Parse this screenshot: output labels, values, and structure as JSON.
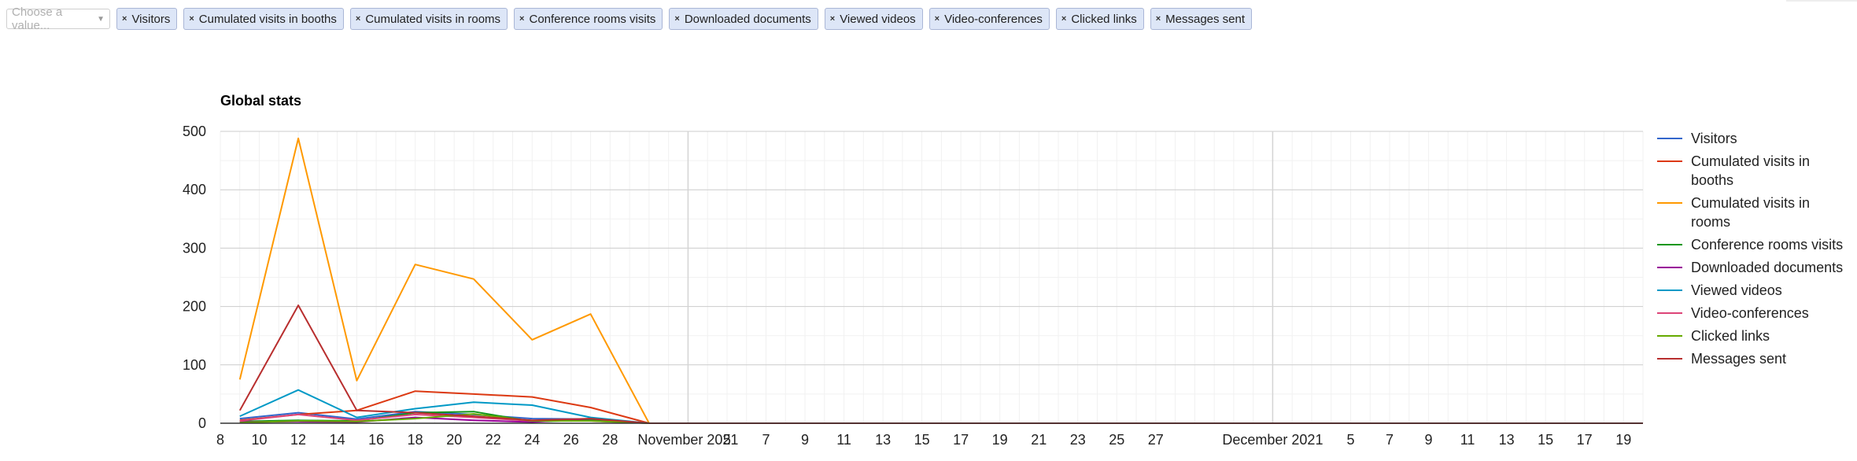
{
  "selector": {
    "placeholder": "Choose a value...",
    "chips": [
      "Visitors",
      "Cumulated visits in booths",
      "Cumulated visits in rooms",
      "Conference rooms visits",
      "Downloaded documents",
      "Viewed videos",
      "Video-conferences",
      "Clicked links",
      "Messages sent"
    ]
  },
  "chart_data": {
    "type": "line",
    "title": "Global stats",
    "xlabel": "",
    "ylabel": "",
    "ylim": [
      0,
      500
    ],
    "yticks": [
      0,
      100,
      200,
      300,
      400,
      500
    ],
    "x": [
      "2021-10-09",
      "2021-10-12",
      "2021-10-15",
      "2021-10-18",
      "2021-10-21",
      "2021-10-24",
      "2021-10-27",
      "2021-10-30",
      "2021-12-20"
    ],
    "xlim": [
      "2021-10-08",
      "2021-12-20"
    ],
    "xtick_labels": [
      {
        "date": "2021-10-08",
        "label": "8"
      },
      {
        "date": "2021-10-10",
        "label": "10"
      },
      {
        "date": "2021-10-12",
        "label": "12"
      },
      {
        "date": "2021-10-14",
        "label": "14"
      },
      {
        "date": "2021-10-16",
        "label": "16"
      },
      {
        "date": "2021-10-18",
        "label": "18"
      },
      {
        "date": "2021-10-20",
        "label": "20"
      },
      {
        "date": "2021-10-22",
        "label": "22"
      },
      {
        "date": "2021-10-24",
        "label": "24"
      },
      {
        "date": "2021-10-26",
        "label": "26"
      },
      {
        "date": "2021-10-28",
        "label": "28"
      },
      {
        "date": "2021-11-01",
        "label": "November 2021"
      },
      {
        "date": "2021-11-03",
        "label": "5"
      },
      {
        "date": "2021-11-05",
        "label": "7"
      },
      {
        "date": "2021-11-07",
        "label": "9"
      },
      {
        "date": "2021-11-09",
        "label": "11"
      },
      {
        "date": "2021-11-11",
        "label": "13"
      },
      {
        "date": "2021-11-13",
        "label": "15"
      },
      {
        "date": "2021-11-15",
        "label": "17"
      },
      {
        "date": "2021-11-17",
        "label": "19"
      },
      {
        "date": "2021-11-19",
        "label": "21"
      },
      {
        "date": "2021-11-21",
        "label": "23"
      },
      {
        "date": "2021-11-23",
        "label": "25"
      },
      {
        "date": "2021-11-25",
        "label": "27"
      },
      {
        "date": "2021-12-01",
        "label": "December 2021"
      },
      {
        "date": "2021-12-05",
        "label": "5"
      },
      {
        "date": "2021-12-07",
        "label": "7"
      },
      {
        "date": "2021-12-09",
        "label": "9"
      },
      {
        "date": "2021-12-11",
        "label": "11"
      },
      {
        "date": "2021-12-13",
        "label": "13"
      },
      {
        "date": "2021-12-15",
        "label": "15"
      },
      {
        "date": "2021-12-17",
        "label": "17"
      },
      {
        "date": "2021-12-19",
        "label": "19"
      }
    ],
    "month_gridlines": [
      "2021-11-01",
      "2021-12-01"
    ],
    "grid": true,
    "legend_position": "right",
    "series": [
      {
        "name": "Visitors",
        "color": "#3366cc",
        "values": [
          8,
          18,
          7,
          20,
          15,
          8,
          7,
          0,
          0
        ]
      },
      {
        "name": "Cumulated visits in booths",
        "color": "#dc3912",
        "values": [
          5,
          15,
          22,
          55,
          50,
          45,
          27,
          0,
          0
        ]
      },
      {
        "name": "Cumulated visits in rooms",
        "color": "#ff9900",
        "values": [
          75,
          488,
          73,
          272,
          247,
          143,
          187,
          0,
          0
        ]
      },
      {
        "name": "Conference rooms visits",
        "color": "#109618",
        "values": [
          3,
          5,
          4,
          18,
          20,
          3,
          5,
          0,
          0
        ]
      },
      {
        "name": "Downloaded documents",
        "color": "#990099",
        "values": [
          2,
          3,
          2,
          10,
          5,
          2,
          8,
          0,
          0
        ]
      },
      {
        "name": "Viewed videos",
        "color": "#0099c6",
        "values": [
          12,
          57,
          10,
          25,
          36,
          31,
          10,
          0,
          0
        ]
      },
      {
        "name": "Video-conferences",
        "color": "#dd4477",
        "values": [
          4,
          15,
          5,
          15,
          10,
          4,
          4,
          0,
          0
        ]
      },
      {
        "name": "Clicked links",
        "color": "#66aa00",
        "values": [
          1,
          4,
          3,
          8,
          16,
          4,
          4,
          0,
          0
        ]
      },
      {
        "name": "Messages sent",
        "color": "#b82e2e",
        "values": [
          22,
          202,
          22,
          18,
          12,
          5,
          8,
          0,
          0
        ]
      }
    ]
  }
}
